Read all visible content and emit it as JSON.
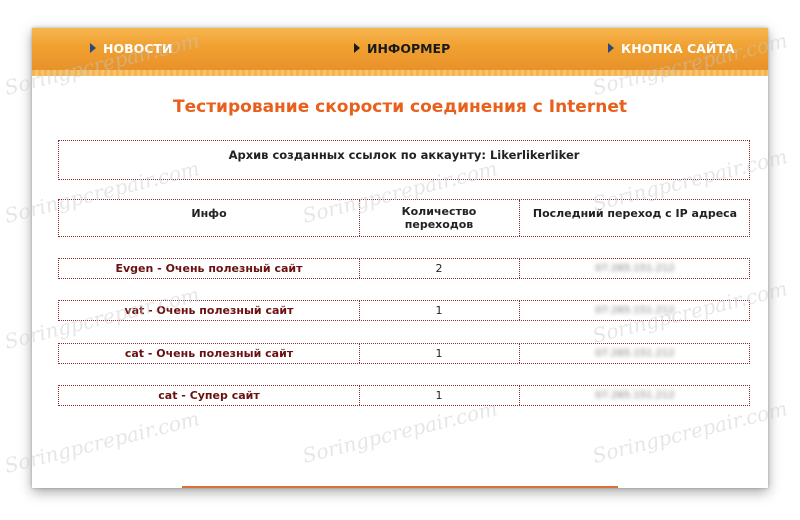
{
  "nav": {
    "items": [
      {
        "label": "НОВОСТИ"
      },
      {
        "label": "ИНФОРМЕР"
      },
      {
        "label": "КНОПКА САЙТА"
      }
    ]
  },
  "page": {
    "title": "Тестирование скорости соединения с Internet",
    "archive_text": "Архив созданных ссылок по аккаунту: Likerlikerliker"
  },
  "table": {
    "headers": [
      "Инфо",
      "Количество переходов",
      "Последний переход с IP адреса"
    ],
    "rows": [
      {
        "site": "Evgen - Очень полезный сайт",
        "count": "2",
        "ip": "07.265.151.212"
      },
      {
        "site": "vat - Очень полезный сайт",
        "count": "1",
        "ip": "07.265.151.212"
      },
      {
        "site": "cat - Очень полезный сайт",
        "count": "1",
        "ip": "07.265.151.212"
      },
      {
        "site": "cat - Супер сайт",
        "count": "1",
        "ip": "07.265.151.212"
      }
    ]
  },
  "watermark": {
    "text": "Soringpcrepair.com"
  },
  "colors": {
    "accent": "#e8601c",
    "nav": "#f0a030",
    "link": "#6a1010"
  }
}
